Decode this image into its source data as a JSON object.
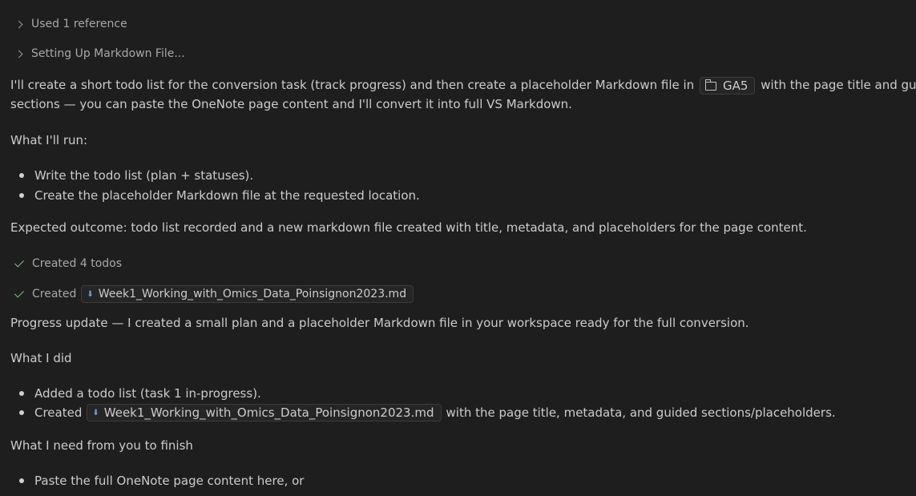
{
  "collapsibles": [
    {
      "label": "Used 1 reference"
    },
    {
      "label": "Setting Up Markdown File..."
    }
  ],
  "intro": {
    "line1_before": "I'll create a short todo list for the conversion task (track progress) and then create a placeholder Markdown file in",
    "folder_chip": "GA5",
    "line1_after": "with the page title and guided",
    "line2": "sections — you can paste the OneNote page content and I'll convert it into full VS Markdown."
  },
  "what_run": {
    "heading": "What I'll run:",
    "items": [
      "Write the todo list (plan + statuses).",
      "Create the placeholder Markdown file at the requested location."
    ]
  },
  "expected": "Expected outcome: todo list recorded and a new markdown file created with title, metadata, and placeholders for the page content.",
  "statuses": [
    {
      "label": "Created 4 todos"
    },
    {
      "label": "Created",
      "file": "Week1_Working_with_Omics_Data_Poinsignon2023.md"
    }
  ],
  "progress": "Progress update — I created a small plan and a placeholder Markdown file in your workspace ready for the full conversion.",
  "what_did": {
    "heading": "What I did",
    "item1": "Added a todo list (task 1 in-progress).",
    "item2_before": "Created",
    "item2_file": "Week1_Working_with_Omics_Data_Poinsignon2023.md",
    "item2_after": "with the page title, metadata, and guided sections/placeholders."
  },
  "need": {
    "heading": "What I need from you to finish",
    "item1": "Paste the full OneNote page content here, or"
  }
}
